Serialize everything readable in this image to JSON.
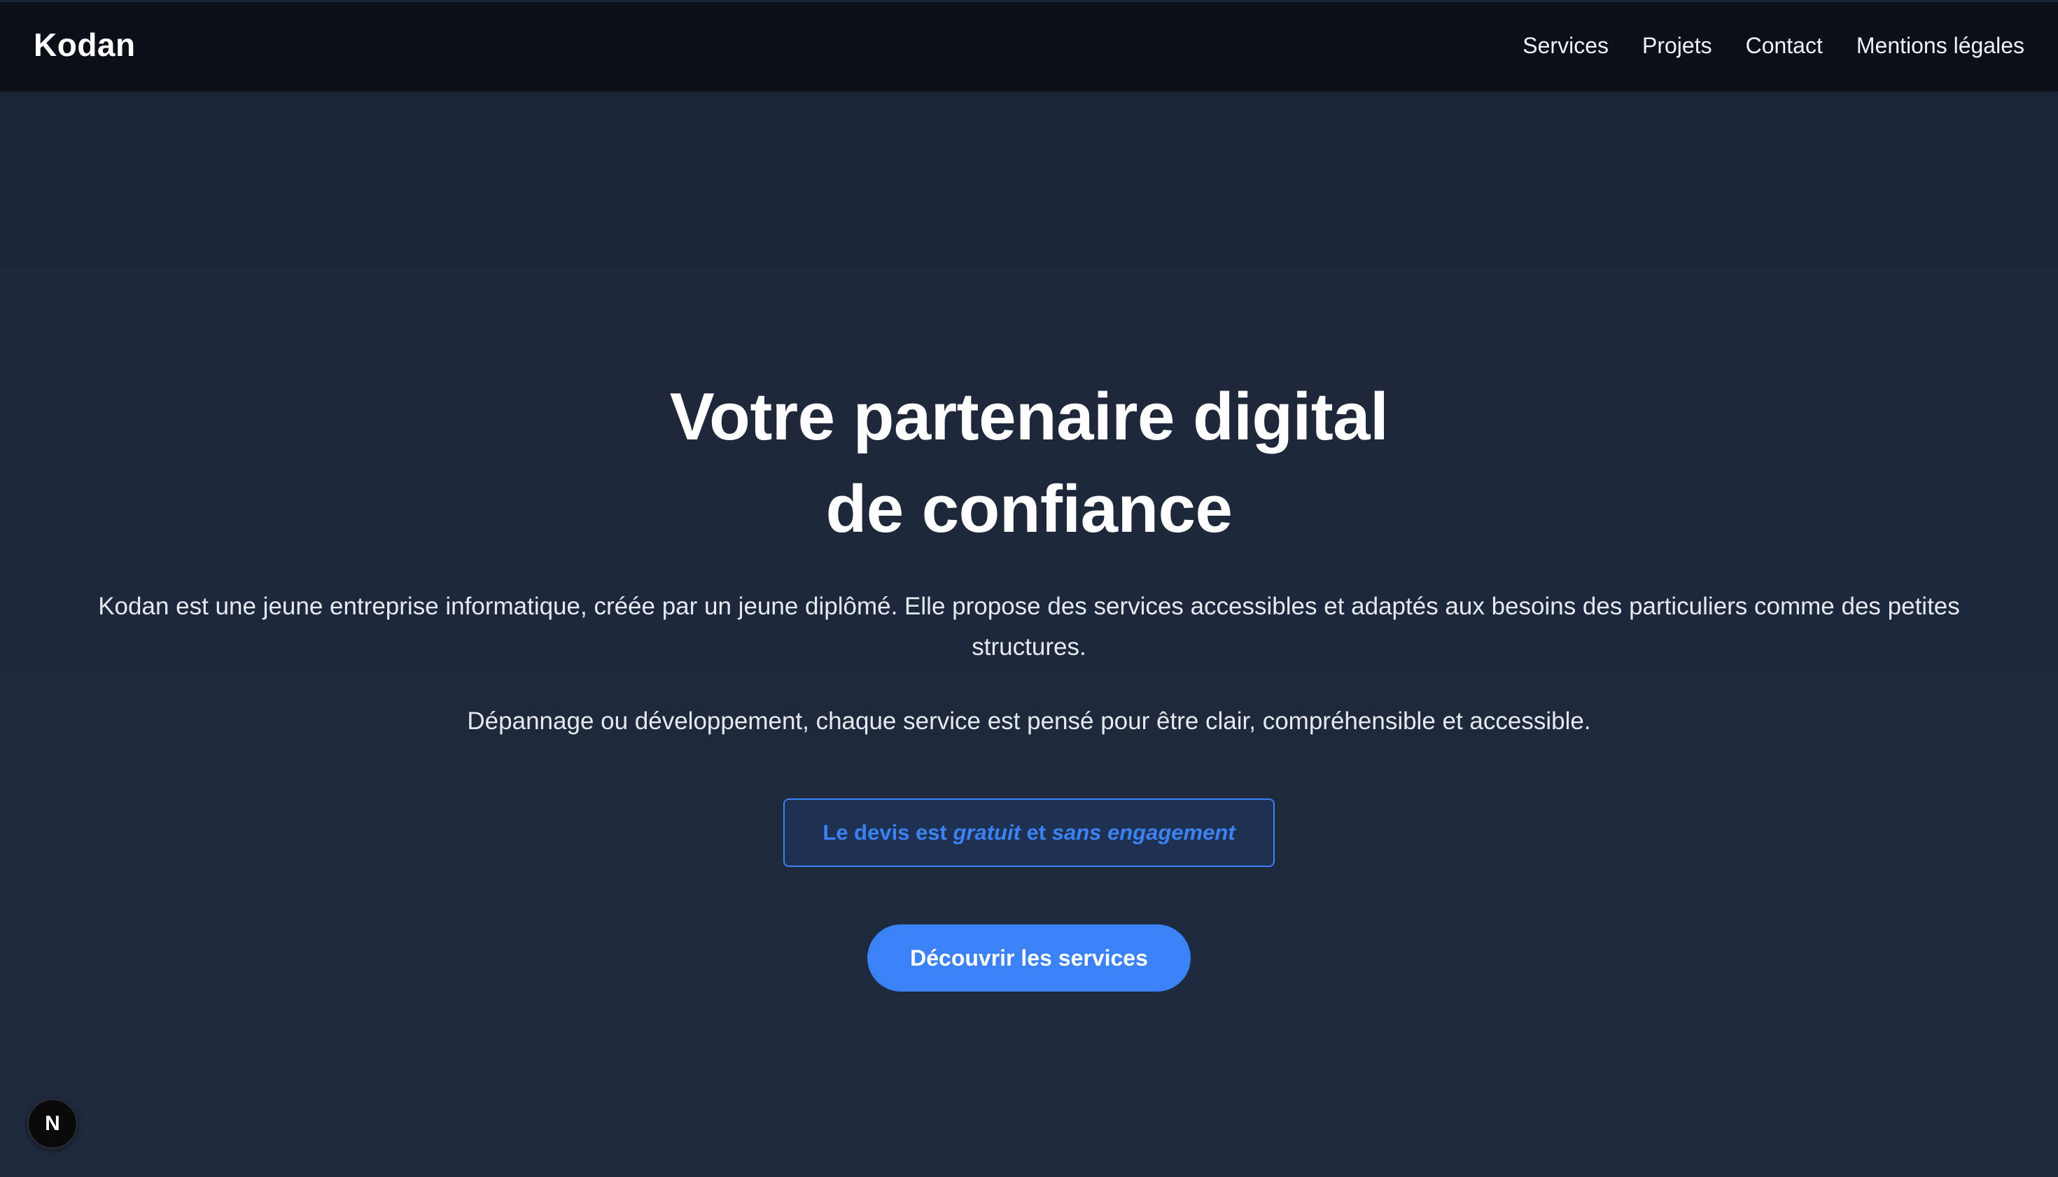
{
  "header": {
    "brand": "Kodan",
    "nav": [
      {
        "label": "Services"
      },
      {
        "label": "Projets"
      },
      {
        "label": "Contact"
      },
      {
        "label": "Mentions légales"
      }
    ]
  },
  "hero": {
    "title_line1": "Votre partenaire digital",
    "title_line2": "de confiance",
    "lead": "Kodan est une jeune entreprise informatique, créée par un jeune diplômé. Elle propose des services accessibles et adaptés aux besoins des particuliers comme des petites structures.",
    "sub": "Dépannage ou développement, chaque service est pensé pour être clair, compréhensible et accessible.",
    "quote_badge": {
      "part1": "Le devis est ",
      "em1": "gratuit",
      "part2": " et ",
      "em2": "sans engagement"
    },
    "cta_label": "Découvrir les services"
  },
  "dev_badge": {
    "icon": "nextjs-icon",
    "letter": "N"
  },
  "colors": {
    "accent": "#3b82f6",
    "header_bg": "#0a0f18",
    "page_bg": "#1e283b"
  }
}
